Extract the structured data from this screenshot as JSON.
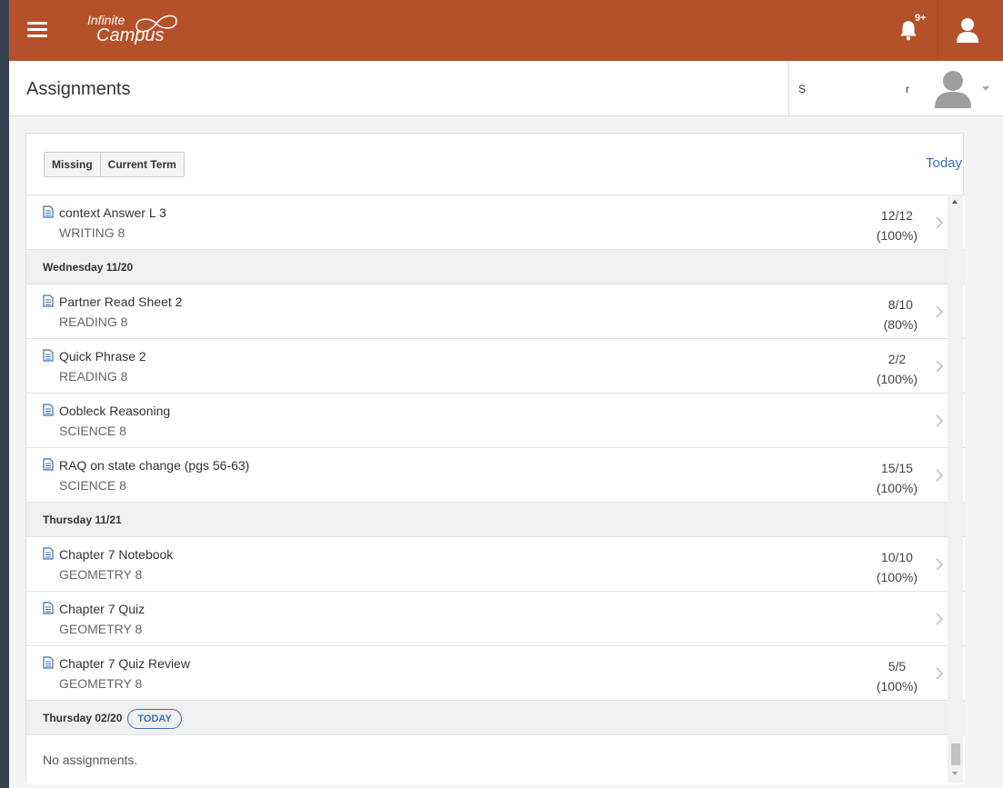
{
  "topbar": {
    "logo_line1": "Infinite",
    "logo_line2": "Campus",
    "notification_badge": "9+"
  },
  "header": {
    "title": "Assignments",
    "student_name_prefix": "S",
    "student_name_suffix": "r"
  },
  "filters": {
    "missing_label": "Missing",
    "term_label": "Current Term",
    "today_link": "Today"
  },
  "list": {
    "row0": {
      "name": "context Answer L 3",
      "course": "WRITING 8",
      "score": "12/12",
      "percent": "(100%)"
    },
    "day1": {
      "label": "Wednesday 11/20"
    },
    "row1": {
      "name": "Partner Read Sheet 2",
      "course": "READING 8",
      "score": "8/10",
      "percent": "(80%)"
    },
    "row2": {
      "name": "Quick Phrase 2",
      "course": "READING 8",
      "score": "2/2",
      "percent": "(100%)"
    },
    "row3": {
      "name": "Oobleck Reasoning",
      "course": "SCIENCE 8",
      "score": "",
      "percent": ""
    },
    "row4": {
      "name": "RAQ on state change (pgs 56-63)",
      "course": "SCIENCE 8",
      "score": "15/15",
      "percent": "(100%)"
    },
    "day2": {
      "label": "Thursday 11/21"
    },
    "row5": {
      "name": "Chapter 7 Notebook",
      "course": "GEOMETRY 8",
      "score": "10/10",
      "percent": "(100%)"
    },
    "row6": {
      "name": "Chapter 7 Quiz",
      "course": "GEOMETRY 8",
      "score": "",
      "percent": ""
    },
    "row7": {
      "name": "Chapter 7 Quiz Review",
      "course": "GEOMETRY 8",
      "score": "5/5",
      "percent": "(100%)"
    },
    "day3": {
      "label": "Thursday 02/20",
      "badge": "TODAY"
    },
    "empty_text": "No assignments."
  },
  "icons": {
    "menu": "hamburger-menu-icon",
    "bell": "bell-icon",
    "user": "user-icon",
    "document": "document-icon",
    "chevron": "chevron-right-icon"
  },
  "colors": {
    "topbar": "#b5512a",
    "link": "#3a6fb0"
  }
}
